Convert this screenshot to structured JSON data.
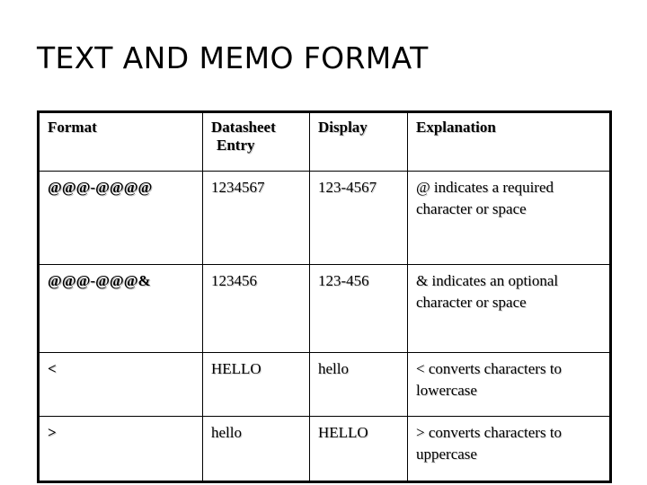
{
  "slide": {
    "title": "TEXT AND MEMO FORMAT"
  },
  "table": {
    "headers": [
      {
        "label": "Format"
      },
      {
        "label": "Datasheet",
        "label_line2": "Entry"
      },
      {
        "label": "Display"
      },
      {
        "label": "Explanation"
      }
    ],
    "rows": [
      {
        "format": "@@@-@@@@",
        "datasheet_entry": "1234567",
        "display": "123-4567",
        "explanation": "@ indicates a required character or space"
      },
      {
        "format": "@@@-@@@&",
        "datasheet_entry": "123456",
        "display": "123-456",
        "explanation": "& indicates an optional character or space"
      },
      {
        "format": "<",
        "datasheet_entry": "HELLO",
        "display": "hello",
        "explanation": "< converts characters to lowercase"
      },
      {
        "format": ">",
        "datasheet_entry": "hello",
        "display": "HELLO",
        "explanation": "> converts characters to uppercase"
      }
    ]
  },
  "colors": {
    "background": "#ffffff",
    "text": "#000000",
    "border": "#000000",
    "text_shadow": "#cfcfcf"
  }
}
